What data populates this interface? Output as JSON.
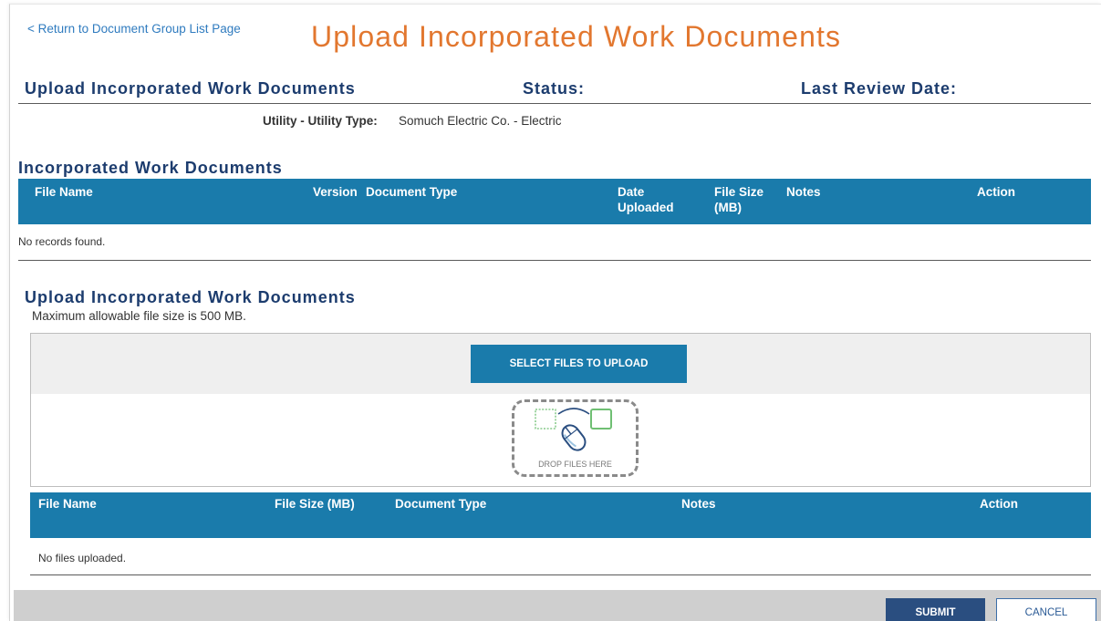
{
  "nav": {
    "back_link": "< Return to Document Group List Page"
  },
  "page_title": "Upload Incorporated Work Documents",
  "summary": {
    "heading": "Upload Incorporated Work Documents",
    "status_label": "Status:",
    "last_review_date_label": "Last Review Date:",
    "utility_label": "Utility - Utility Type:",
    "utility_value": "Somuch Electric Co. - Electric"
  },
  "documents_table": {
    "heading": "Incorporated Work Documents",
    "columns": [
      "File Name",
      "Version",
      "Document Type",
      "Date Uploaded",
      "File Size (MB)",
      "Notes",
      "Action"
    ],
    "empty_message": "No records found."
  },
  "upload": {
    "heading": "Upload Incorporated Work Documents",
    "note": "Maximum allowable file size is 500 MB.",
    "select_button": "SELECT FILES TO UPLOAD",
    "drop_label": "DROP FILES HERE",
    "columns": [
      "File Name",
      "File Size (MB)",
      "Document Type",
      "Notes",
      "Action"
    ],
    "empty_message": "No files uploaded."
  },
  "footer": {
    "submit_label": "SUBMIT",
    "cancel_label": "CANCEL"
  },
  "icons": {
    "drop_zone": [
      "dotted-file-icon",
      "file-icon",
      "drag-arc-icon",
      "mouse-icon"
    ]
  },
  "colors": {
    "link": "#2f7bbf",
    "title": "#e2772f",
    "heading": "#1c3c6e",
    "table_header": "#1a7bab",
    "submit": "#2a4e80",
    "footer": "#cfcfcf",
    "drop_icon_green": "#6fbf73"
  }
}
